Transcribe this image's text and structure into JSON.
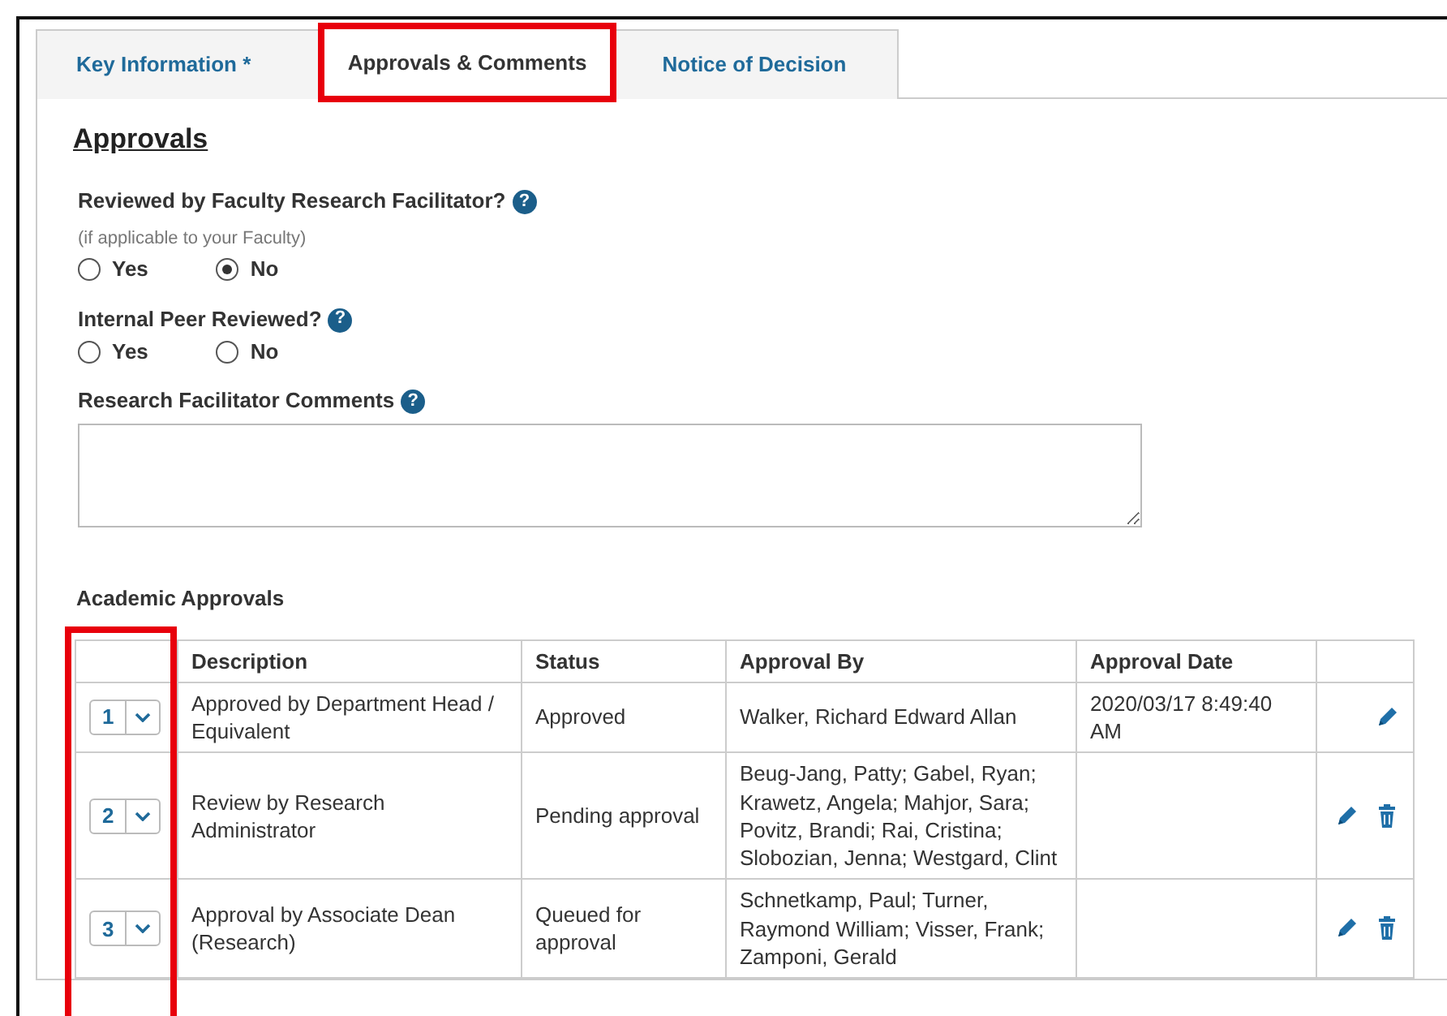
{
  "tabs": [
    {
      "label": "Key Information *",
      "selected": false,
      "highlighted": false
    },
    {
      "label": "Approvals & Comments",
      "selected": true,
      "highlighted": true
    },
    {
      "label": "Notice of Decision",
      "selected": false,
      "highlighted": false
    }
  ],
  "section_title": "Approvals",
  "questions": [
    {
      "kind": "radio",
      "label": "Reviewed by Faculty Research Facilitator?",
      "help": "?",
      "hint": "(if applicable to your Faculty)",
      "options": [
        {
          "label": "Yes",
          "selected": false
        },
        {
          "label": "No",
          "selected": true
        }
      ]
    },
    {
      "kind": "radio",
      "label": "Internal Peer Reviewed?",
      "help": "?",
      "options": [
        {
          "label": "Yes",
          "selected": false
        },
        {
          "label": "No",
          "selected": false
        }
      ]
    },
    {
      "kind": "textarea",
      "label": "Research Facilitator Comments",
      "help": "?"
    }
  ],
  "table": {
    "title": "Academic Approvals",
    "order_column_highlighted": true,
    "columns": [
      "Description",
      "Status",
      "Approval By",
      "Approval Date"
    ],
    "rows": [
      {
        "order": "1",
        "description": "Approved by Department Head / Equivalent",
        "status": "Approved",
        "approval_by": "Walker, Richard Edward Allan",
        "approval_date": "2020/03/17 8:49:40 AM",
        "deletable": false
      },
      {
        "order": "2",
        "description": "Review by Research Administrator",
        "status": "Pending approval",
        "approval_by": "Beug-Jang, Patty; Gabel, Ryan; Krawetz, Angela; Mahjor, Sara; Povitz, Brandi; Rai, Cristina; Slobozian, Jenna; Westgard, Clint",
        "deletable": true
      },
      {
        "order": "3",
        "description": "Approval by Associate Dean (Research)",
        "status": "Queued for approval",
        "approval_by": "Schnetkamp, Paul; Turner, Raymond William; Visser, Frank; Zamponi, Gerald",
        "deletable": true
      }
    ]
  }
}
